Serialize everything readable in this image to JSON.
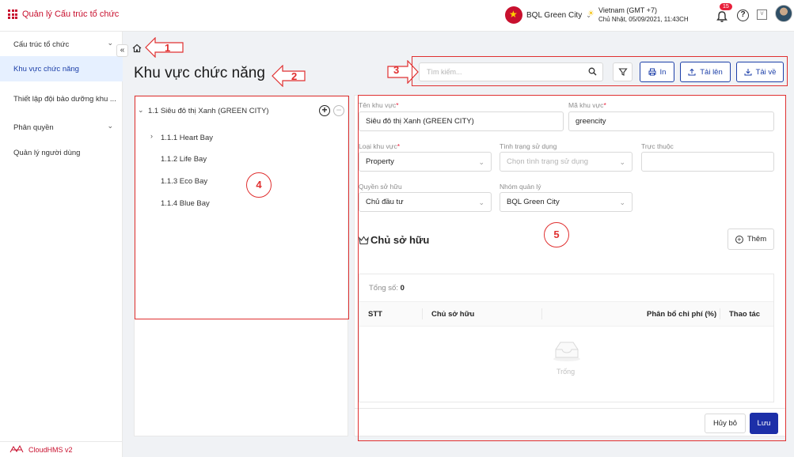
{
  "header": {
    "app_title": "Quản lý Cấu trúc tổ chức",
    "org_name": "BQL Green City",
    "timezone": "Vietnam (GMT +7)",
    "datetime": "Chủ Nhật, 05/09/2021, 11:43CH",
    "notification_count": "15",
    "help_glyph": "?",
    "box_glyph": "V"
  },
  "sidebar": {
    "items": [
      {
        "label": "Cấu trúc tổ chức",
        "expandable": true
      },
      {
        "label": "Khu vực chức năng",
        "active": true
      },
      {
        "label": "Thiết lập đội bảo dưỡng khu ..."
      },
      {
        "label": "Phân quyền",
        "expandable": true
      },
      {
        "label": "Quản lý người dùng"
      }
    ],
    "footer": "CloudHMS v2",
    "collapse_glyph": "«"
  },
  "page": {
    "title": "Khu vực chức năng"
  },
  "toolbar": {
    "search_placeholder": "Tìm kiếm...",
    "print_label": "In",
    "upload_label": "Tải lên",
    "download_label": "Tải về"
  },
  "tree": {
    "root": "1.1 Siêu đô thị Xanh (GREEN CITY)",
    "children": [
      "1.1.1 Heart Bay",
      "1.1.2 Life Bay",
      "1.1.3 Eco Bay",
      "1.1.4 Blue Bay"
    ]
  },
  "form": {
    "area_name_label": "Tên khu vực",
    "area_name_value": "Siêu đô thị Xanh (GREEN CITY)",
    "area_code_label": "Mã khu vực",
    "area_code_value": "greencity",
    "area_type_label": "Loại khu vực",
    "area_type_value": "Property",
    "usage_status_label": "Tình trạng sử dụng",
    "usage_status_placeholder": "Chọn tình trạng sử dụng",
    "belongs_to_label": "Trực thuộc",
    "belongs_to_value": "",
    "ownership_label": "Quyền sở hữu",
    "ownership_value": "Chủ đầu tư",
    "mgmt_group_label": "Nhóm quản lý",
    "mgmt_group_value": "BQL Green City",
    "required_mark": "*"
  },
  "owners": {
    "title": "Chủ sở hữu",
    "add_label": "Thêm",
    "total_label": "Tổng số:",
    "total_value": "0",
    "columns": [
      "STT",
      "Chủ sở hữu",
      "Phân bổ chi phí (%)",
      "Thao tác"
    ],
    "empty_text": "Trống"
  },
  "actions": {
    "cancel_label": "Hủy bỏ",
    "save_label": "Lưu"
  },
  "annotations": {
    "markers": [
      "1",
      "2",
      "3",
      "4",
      "5"
    ]
  },
  "colors": {
    "brand_red": "#c8102e",
    "primary_blue": "#1c3fa8",
    "annotation_red": "#e03030"
  }
}
